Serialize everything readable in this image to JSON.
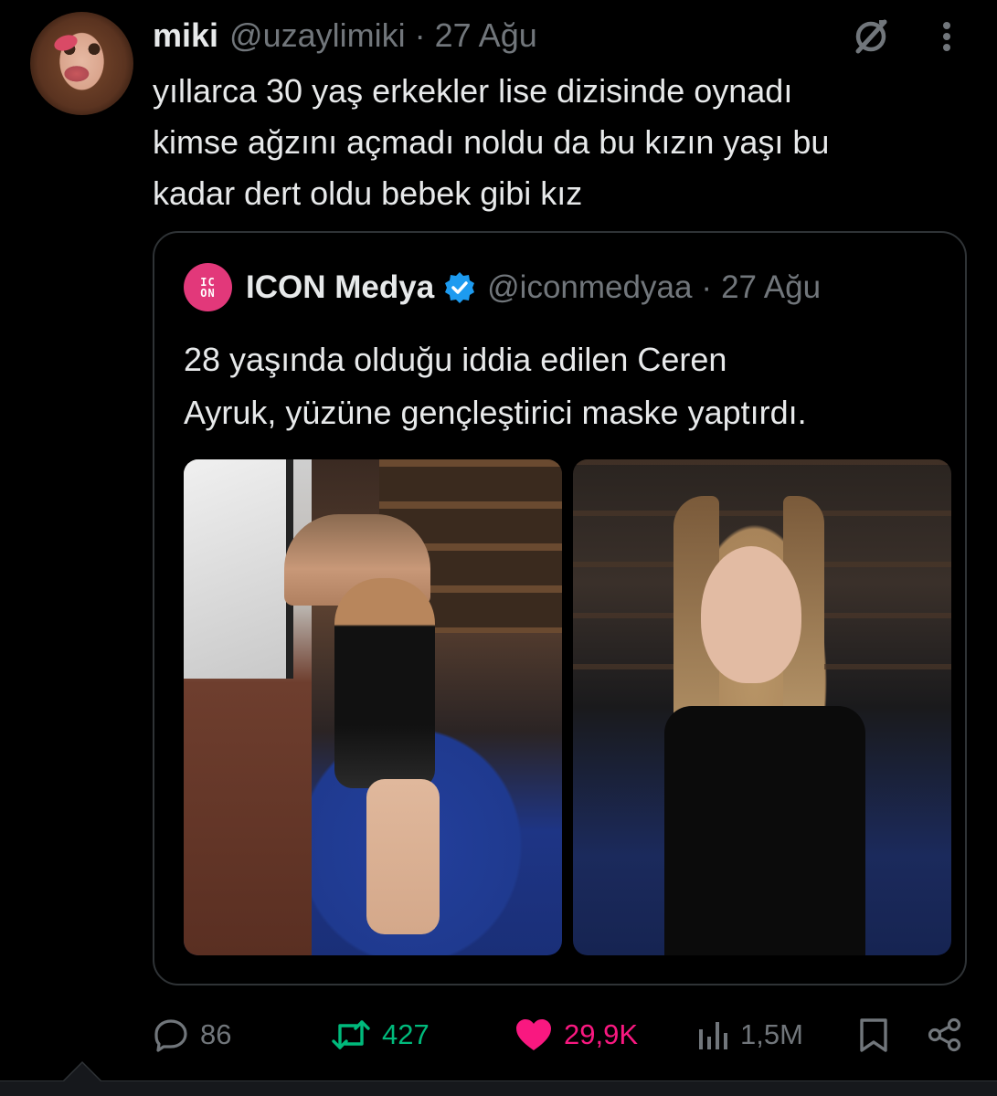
{
  "tweet": {
    "author_name": "miki",
    "author_handle": "@uzaylimiki",
    "separator": "·",
    "timestamp": "27 Ağu",
    "text_lines": [
      "yıllarca 30 yaş erkekler lise dizisinde oynadı",
      "kimse ağzını açmadı noldu da bu kızın yaşı bu",
      "kadar dert oldu bebek gibi kız"
    ]
  },
  "quote": {
    "avatar_text_top": "IC",
    "avatar_text_bottom": "ON",
    "author_name": "ICON Medya",
    "verified": true,
    "author_handle": "@iconmedyaa",
    "separator": "·",
    "timestamp": "27 Ağu",
    "text_lines": [
      "28 yaşında olduğu iddia edilen Ceren",
      "Ayruk, yüzüne gençleştirici maske yaptırdı."
    ]
  },
  "actions": {
    "replies": "86",
    "retweets": "427",
    "likes": "29,9K",
    "views": "1,5M"
  },
  "icons": {
    "grok": "grok-icon",
    "more": "more-vertical-icon",
    "reply": "reply-icon",
    "retweet": "retweet-icon",
    "like": "heart-icon",
    "views": "views-icon",
    "bookmark": "bookmark-icon",
    "share": "share-icon"
  },
  "colors": {
    "background": "#000000",
    "text_primary": "#e7e9ea",
    "text_secondary": "#71767b",
    "border": "#2f3336",
    "retweet_active": "#00ba7c",
    "like_active": "#f91880",
    "verified_blue": "#1d9bf0",
    "icon_avatar_pink": "#e2387a"
  }
}
